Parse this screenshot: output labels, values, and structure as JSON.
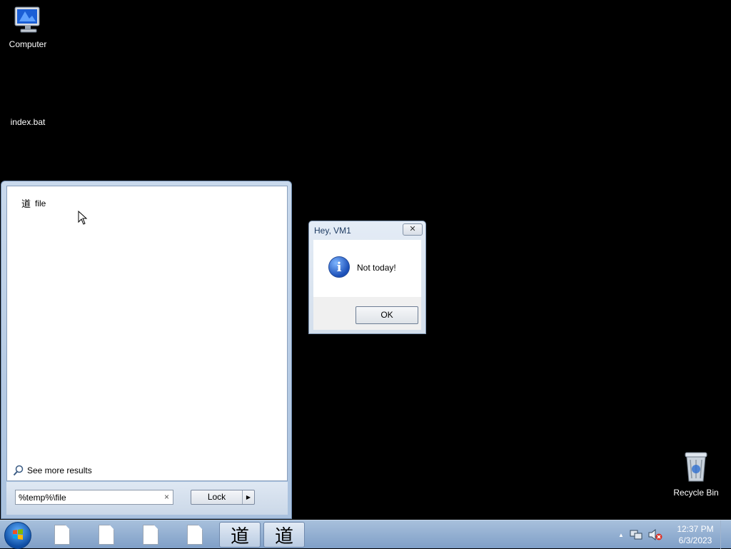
{
  "desktop": {
    "icons": {
      "computer": {
        "label": "Computer",
        "icon": "computer-icon"
      },
      "index_bat": {
        "label": "index.bat",
        "icon": "batch-file-icon"
      },
      "recycle_bin": {
        "label": "Recycle Bin",
        "icon": "recycle-bin-icon"
      }
    }
  },
  "start_menu": {
    "results": [
      {
        "glyph": "道",
        "label": "file"
      }
    ],
    "see_more": "See more results",
    "search_value": "%temp%\\file",
    "clear_glyph": "×",
    "lock_label": "Lock",
    "lock_arrow": "▶"
  },
  "message_box": {
    "title": "Hey, VM1",
    "close_glyph": "✕",
    "icon_glyph": "i",
    "text": "Not today!",
    "ok_label": "OK"
  },
  "taskbar": {
    "buttons": [
      {
        "type": "doc"
      },
      {
        "type": "doc"
      },
      {
        "type": "doc"
      },
      {
        "type": "doc"
      },
      {
        "type": "tao",
        "glyph": "道"
      },
      {
        "type": "tao",
        "glyph": "道"
      }
    ],
    "tray": {
      "show_hidden": "▲",
      "network": "network-icon",
      "volume": "volume-muted-icon"
    },
    "clock": {
      "time": "12:37 PM",
      "date": "6/3/2023"
    }
  },
  "colors": {
    "desktop_bg": "#000000",
    "taskbar": "#8fabd0",
    "info_icon": "#1b4fb8"
  }
}
